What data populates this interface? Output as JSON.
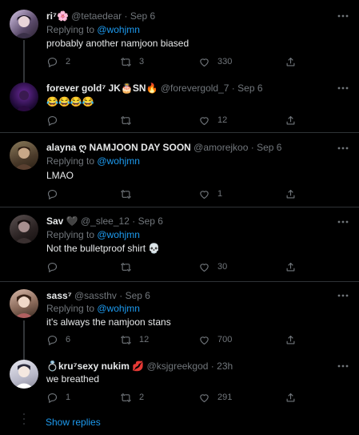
{
  "colors": {
    "background": "#000000",
    "accent": "#1d9bf0",
    "muted": "#71767b",
    "border": "#2f3336"
  },
  "tweets": [
    {
      "name": "ri⁷🌸",
      "handle": "@tetaedear",
      "dot": "·",
      "date": "Sep 6",
      "replying_prefix": "Replying to ",
      "replying_to": "@wohjmn",
      "text": "probably another namjoon biased",
      "replies": "2",
      "retweets": "3",
      "likes": "330"
    },
    {
      "name": "forever gold⁷ JK🎂SN🔥",
      "handle": "@forevergold_7",
      "dot": "·",
      "date": "Sep 6",
      "text": "😂😂😂😂",
      "replies": "",
      "retweets": "",
      "likes": "12"
    },
    {
      "name": "alayna ღ NAMJOON DAY SOON",
      "handle": "@amorejkoo",
      "dot": "·",
      "date": "Sep 6",
      "replying_prefix": "Replying to ",
      "replying_to": "@wohjmn",
      "text": "LMAO",
      "replies": "",
      "retweets": "",
      "likes": "1"
    },
    {
      "name": "Sav 🖤",
      "handle": "@_slee_12",
      "dot": "·",
      "date": "Sep 6",
      "replying_prefix": "Replying to ",
      "replying_to": "@wohjmn",
      "text": "Not the bulletproof shirt 💀",
      "replies": "",
      "retweets": "",
      "likes": "30"
    },
    {
      "name": "sass⁷",
      "handle": "@sassthv",
      "dot": "·",
      "date": "Sep 6",
      "replying_prefix": "Replying to ",
      "replying_to": "@wohjmn",
      "text": "it's always the namjoon stans",
      "replies": "6",
      "retweets": "12",
      "likes": "700"
    },
    {
      "name": "💍kru⁷sexy nukim 💋",
      "handle": "@ksjgreekgod",
      "dot": "·",
      "date": "23h",
      "text": "we breathed",
      "replies": "1",
      "retweets": "2",
      "likes": "291"
    }
  ],
  "show_replies": "Show replies"
}
